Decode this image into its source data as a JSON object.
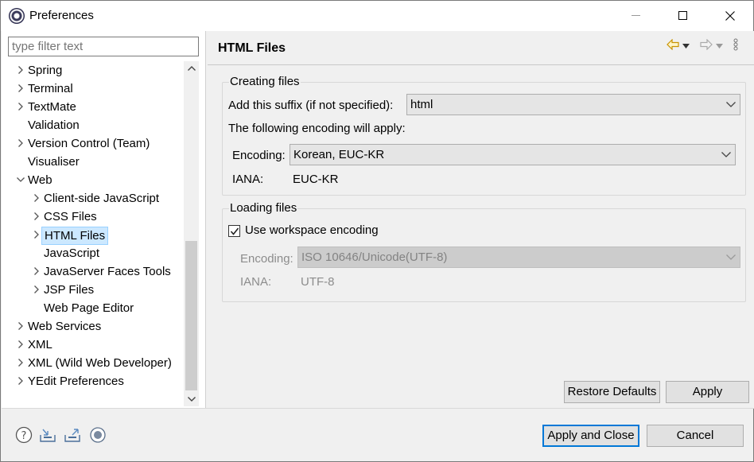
{
  "window": {
    "title": "Preferences"
  },
  "left": {
    "filter_placeholder": "type filter text",
    "tree": [
      {
        "label": "Spring",
        "expandable": true
      },
      {
        "label": "Terminal",
        "expandable": true
      },
      {
        "label": "TextMate",
        "expandable": true
      },
      {
        "label": "Validation",
        "expandable": false
      },
      {
        "label": "Version Control (Team)",
        "expandable": true
      },
      {
        "label": "Visualiser",
        "expandable": false
      },
      {
        "label": "Web",
        "expandable": true,
        "expanded": true
      },
      {
        "label": "Client-side JavaScript",
        "expandable": true,
        "child": true
      },
      {
        "label": "CSS Files",
        "expandable": true,
        "child": true
      },
      {
        "label": "HTML Files",
        "expandable": true,
        "child": true,
        "selected": true
      },
      {
        "label": "JavaScript",
        "expandable": false,
        "child": true
      },
      {
        "label": "JavaServer Faces Tools",
        "expandable": true,
        "child": true
      },
      {
        "label": "JSP Files",
        "expandable": true,
        "child": true
      },
      {
        "label": "Web Page Editor",
        "expandable": false,
        "child": true
      },
      {
        "label": "Web Services",
        "expandable": true
      },
      {
        "label": "XML",
        "expandable": true
      },
      {
        "label": "XML (Wild Web Developer)",
        "expandable": true
      },
      {
        "label": "YEdit Preferences",
        "expandable": true
      }
    ]
  },
  "page": {
    "title": "HTML Files",
    "creating": {
      "group_title": "Creating files",
      "suffix_label": "Add this suffix (if not specified):",
      "suffix_value": "html",
      "encoding_note": "The following encoding will apply:",
      "encoding_label": "Encoding:",
      "encoding_value": "Korean, EUC-KR",
      "iana_label": "IANA:",
      "iana_value": "EUC-KR"
    },
    "loading": {
      "group_title": "Loading files",
      "workspace_label": "Use workspace encoding",
      "workspace_checked": true,
      "encoding_label": "Encoding:",
      "encoding_value": "ISO 10646/Unicode(UTF-8)",
      "iana_label": "IANA:",
      "iana_value": "UTF-8"
    },
    "restore_defaults": "Restore Defaults",
    "apply": "Apply"
  },
  "footer": {
    "apply_close": "Apply and Close",
    "cancel": "Cancel"
  },
  "colors": {
    "accent": "#0078d7",
    "selection_bg": "#cce8ff",
    "nav_arrow_active": "#d9a300"
  }
}
